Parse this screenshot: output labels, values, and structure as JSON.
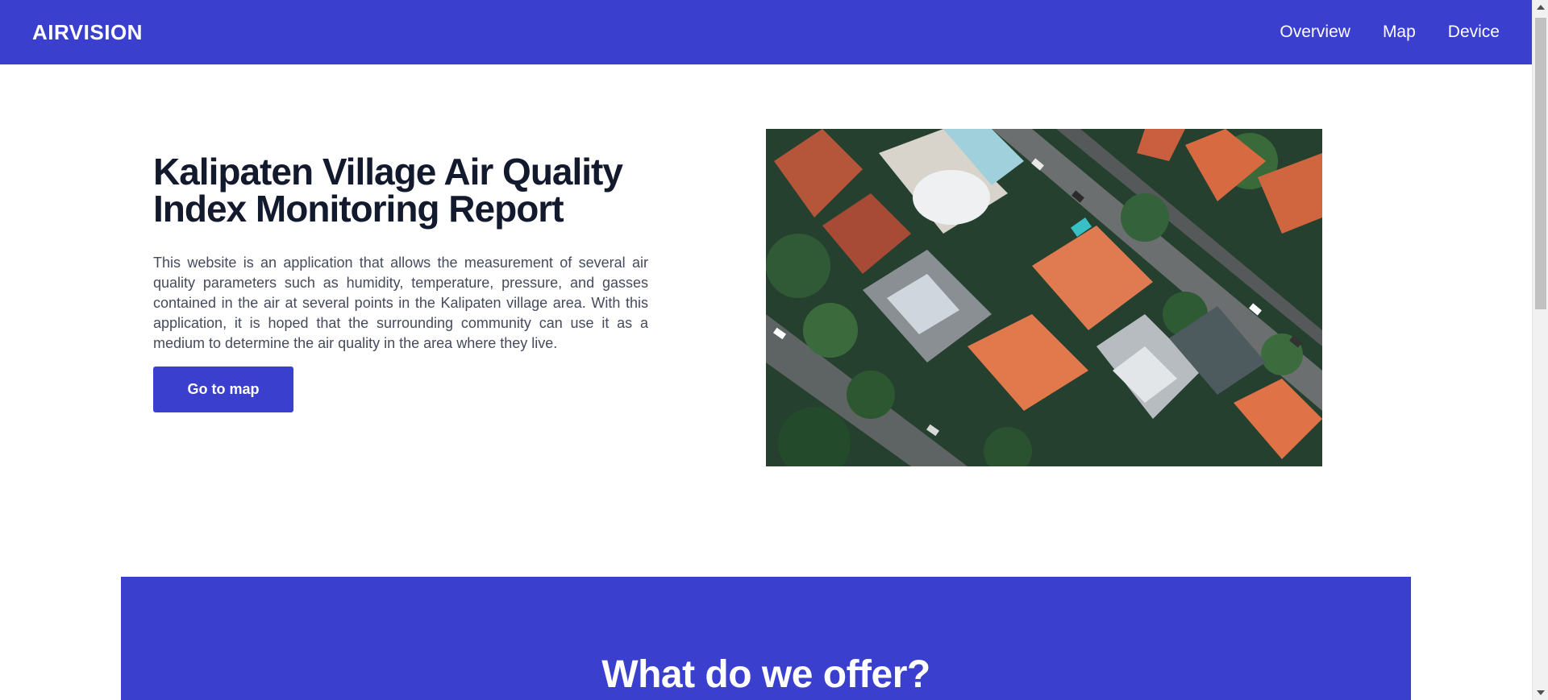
{
  "navbar": {
    "brand": "AIRVISION",
    "links": [
      {
        "label": "Overview"
      },
      {
        "label": "Map"
      },
      {
        "label": "Device"
      }
    ]
  },
  "hero": {
    "title_line1": "Kalipaten Village Air Quality",
    "title_line2": "Index Monitoring Report",
    "description": "This website is an application that allows the measurement of several air quality parameters such as humidity, temperature, pressure, and gasses contained in the air at several points in the Kalipaten village area. With this application, it is hoped that the surrounding community can use it as a medium to determine the air quality in the area where they live.",
    "cta_label": "Go to map"
  },
  "offer": {
    "title": "What do we offer?"
  },
  "colors": {
    "brand": "#3a3fce",
    "heading": "#131a2e",
    "body_text": "#454b5c"
  }
}
